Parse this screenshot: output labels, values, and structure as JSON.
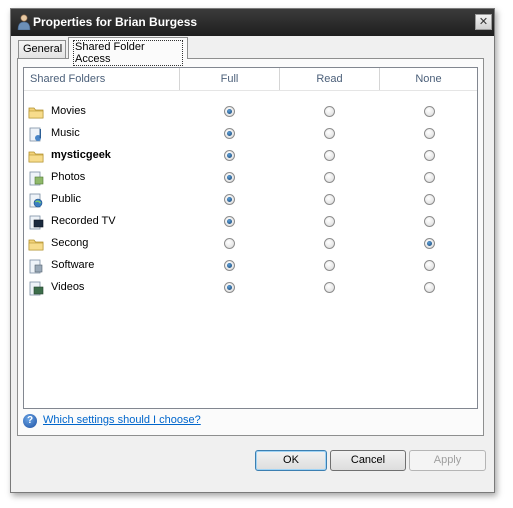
{
  "window": {
    "title": "Properties for Brian Burgess"
  },
  "tabs": [
    {
      "label": "General"
    },
    {
      "label": "Shared Folder Access"
    }
  ],
  "table": {
    "headers": {
      "folders": "Shared Folders",
      "full": "Full",
      "read": "Read",
      "none": "None"
    },
    "rows": [
      {
        "name": "Movies",
        "access": "full",
        "icon": "folder-icon"
      },
      {
        "name": "Music",
        "access": "full",
        "icon": "music-folder-icon"
      },
      {
        "name": "mysticgeek",
        "access": "full",
        "icon": "folder-icon",
        "bold": true
      },
      {
        "name": "Photos",
        "access": "full",
        "icon": "photos-folder-icon"
      },
      {
        "name": "Public",
        "access": "full",
        "icon": "public-folder-icon"
      },
      {
        "name": "Recorded TV",
        "access": "full",
        "icon": "tv-folder-icon"
      },
      {
        "name": "Secong",
        "access": "none",
        "icon": "folder-icon"
      },
      {
        "name": "Software",
        "access": "full",
        "icon": "software-folder-icon"
      },
      {
        "name": "Videos",
        "access": "full",
        "icon": "videos-folder-icon"
      }
    ]
  },
  "help": {
    "link": "Which settings should I choose?"
  },
  "buttons": {
    "ok": "OK",
    "cancel": "Cancel",
    "apply": "Apply"
  },
  "colors": {
    "selected_radio": "#1f5f9e",
    "link": "#0066cc",
    "titlebar": "#2a2a2a"
  }
}
